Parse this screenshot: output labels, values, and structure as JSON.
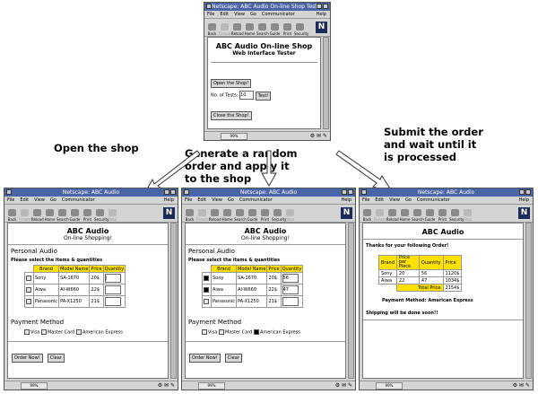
{
  "captions": {
    "open": "Open the shop",
    "generate": [
      "Generate a random",
      "order and apply it",
      "to the shop"
    ],
    "submit": [
      "Submit the order",
      "and wait until it",
      "is processed"
    ]
  },
  "menu": {
    "file": "File",
    "edit": "Edit",
    "view": "View",
    "go": "Go",
    "communicator": "Communicator",
    "help": "Help"
  },
  "toolbar": [
    "Back",
    "Forward",
    "Reload",
    "Home",
    "Search",
    "Guide",
    "Print",
    "Security",
    "Stop"
  ],
  "status_pct": "99%",
  "tester": {
    "title": "Netscape: ABC Audio On-line Shop Tester",
    "heading": "ABC Audio On-line Shop",
    "subheading": "Web Interface Tester",
    "open_button": "Open the Shop!",
    "tests_label": "No. of Tests:",
    "tests_value": "10",
    "test_button": "Test!",
    "close_button": "Close the Shop!"
  },
  "shop": {
    "title": "Netscape: ABC Audio",
    "heading": "ABC Audio",
    "subheading": "On-line Shopping!",
    "personal": "Personal Audio",
    "instruction": "Please select the items & quantities",
    "columns": [
      "Brand",
      "Model Name",
      "Price",
      "Quantity"
    ],
    "rows": [
      {
        "brand": "Sony",
        "model": "SA-1670",
        "price": "20$"
      },
      {
        "brand": "Aiwa",
        "model": "AI-W660",
        "price": "22$"
      },
      {
        "brand": "Panasonic",
        "model": "PA-X1250",
        "price": "21$"
      }
    ],
    "payment_heading": "Payment Method",
    "payment": [
      "Visa",
      "Master Card",
      "American Express"
    ],
    "order_button": "Order Now!",
    "clear_button": "Clear"
  },
  "filled_quantities": [
    "56",
    "47",
    ""
  ],
  "result": {
    "title": "Netscape: ABC Audio",
    "heading": "ABC Audio",
    "thanks": "Thanks for your following Order!",
    "columns": [
      "Brand",
      "Price per Piece",
      "Quantity",
      "Price"
    ],
    "rows": [
      {
        "brand": "Sony",
        "ppp": "20",
        "qty": "56",
        "price": "1120$"
      },
      {
        "brand": "Aiwa",
        "ppp": "22",
        "qty": "47",
        "price": "1034$"
      }
    ],
    "total_label": "Total Price",
    "total_value": "2154$",
    "payment_line": "Payment Method: American Express",
    "shipping": "Shipping will be done soon!!"
  }
}
